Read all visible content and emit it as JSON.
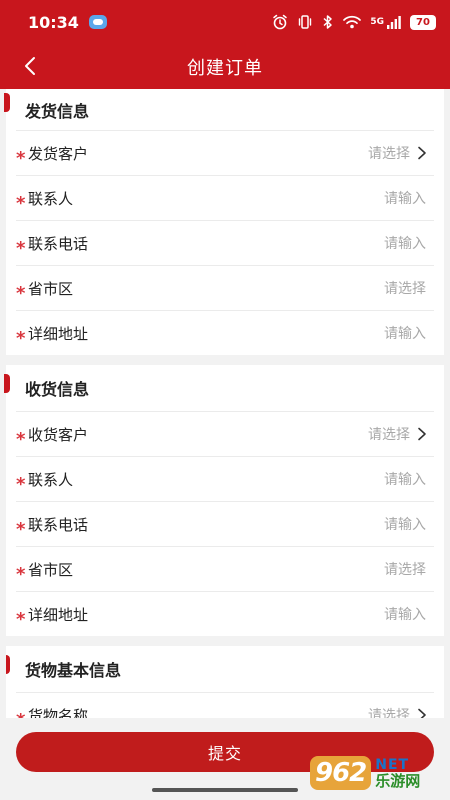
{
  "status_bar": {
    "time": "10:34",
    "network": "5G",
    "battery": "70"
  },
  "nav": {
    "title": "创建订单"
  },
  "sections": [
    {
      "title": "发货信息",
      "rows": [
        {
          "label": "发货客户",
          "value": "请选择",
          "chevron": true
        },
        {
          "label": "联系人",
          "value": "请输入",
          "chevron": false
        },
        {
          "label": "联系电话",
          "value": "请输入",
          "chevron": false
        },
        {
          "label": "省市区",
          "value": "请选择",
          "chevron": false
        },
        {
          "label": "详细地址",
          "value": "请输入",
          "chevron": false
        }
      ]
    },
    {
      "title": "收货信息",
      "rows": [
        {
          "label": "收货客户",
          "value": "请选择",
          "chevron": true
        },
        {
          "label": "联系人",
          "value": "请输入",
          "chevron": false
        },
        {
          "label": "联系电话",
          "value": "请输入",
          "chevron": false
        },
        {
          "label": "省市区",
          "value": "请选择",
          "chevron": false
        },
        {
          "label": "详细地址",
          "value": "请输入",
          "chevron": false
        }
      ]
    },
    {
      "title": "货物基本信息",
      "rows": [
        {
          "label": "货物名称",
          "value": "请选择",
          "chevron": true
        }
      ]
    }
  ],
  "required_mark": "*",
  "submit": {
    "label": "提交"
  },
  "watermark": {
    "brand": "962",
    "line1": "NET",
    "line2": "乐游网"
  },
  "colors": {
    "primary": "#c8161d",
    "button": "#c01c1c",
    "required": "#d9363e",
    "placeholder": "#a8a8a8"
  }
}
